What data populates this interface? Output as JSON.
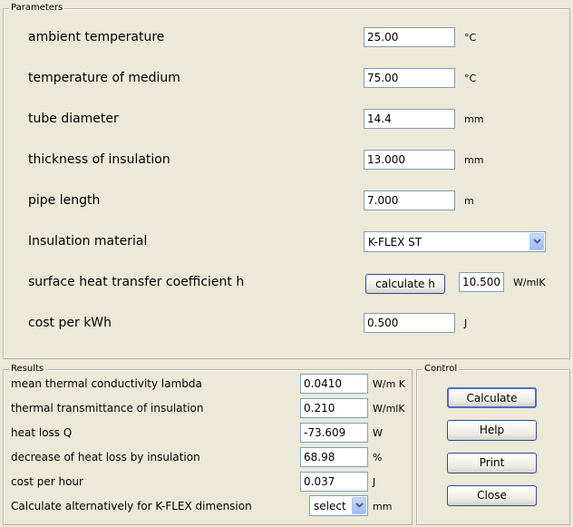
{
  "parameters": {
    "title": "Parameters",
    "rows": [
      {
        "label": "ambient temperature",
        "value": "25.00",
        "unit": "°C"
      },
      {
        "label": "temperature of medium",
        "value": "75.00",
        "unit": "°C"
      },
      {
        "label": "tube diameter",
        "value": "14.4",
        "unit": "mm"
      },
      {
        "label": "thickness of insulation",
        "value": "13.000",
        "unit": "mm"
      },
      {
        "label": "pipe length",
        "value": "7.000",
        "unit": "m"
      }
    ],
    "material": {
      "label": "Insulation material",
      "value": "K-FLEX ST"
    },
    "htc": {
      "label": "surface heat transfer coefficient h",
      "button": "calculate h",
      "value": "10.500",
      "unit": "W/mlK"
    },
    "cost": {
      "label": "cost per kWh",
      "value": "0.500",
      "unit": "J"
    }
  },
  "results": {
    "title": "Results",
    "rows": [
      {
        "label": "mean thermal conductivity lambda",
        "value": "0.0410",
        "unit": "W/m K"
      },
      {
        "label": "thermal transmittance of insulation",
        "value": "0.210",
        "unit": "W/mlK"
      },
      {
        "label": "heat loss Q",
        "value": "-73.609",
        "unit": "W"
      },
      {
        "label": "decrease of heat loss by insulation",
        "value": "68.98",
        "unit": "%"
      },
      {
        "label": "cost per hour",
        "value": "0.037",
        "unit": "J"
      }
    ],
    "alt": {
      "label": "Calculate alternatively for K-FLEX dimension",
      "value": "select",
      "unit": "mm"
    }
  },
  "control": {
    "title": "Control",
    "calculate": "Calculate",
    "help": "Help",
    "print": "Print",
    "close": "Close"
  }
}
